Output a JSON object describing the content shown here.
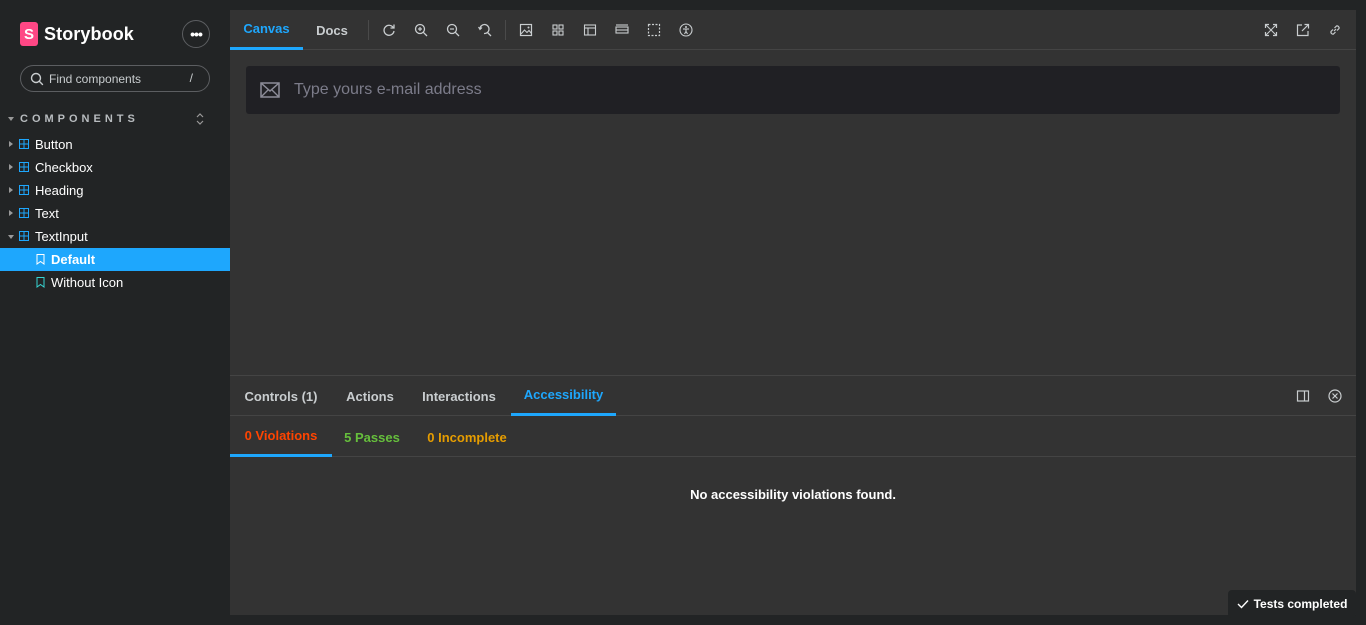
{
  "sidebar": {
    "brand": {
      "logo_letter": "S",
      "name": "Storybook"
    },
    "menu_button": "•••",
    "search": {
      "placeholder": "Find components",
      "shortcut": "/"
    },
    "section_title": "COMPONENTS",
    "items": [
      {
        "label": "Button",
        "type": "component",
        "expanded": false
      },
      {
        "label": "Checkbox",
        "type": "component",
        "expanded": false
      },
      {
        "label": "Heading",
        "type": "component",
        "expanded": false
      },
      {
        "label": "Text",
        "type": "component",
        "expanded": false
      },
      {
        "label": "TextInput",
        "type": "component",
        "expanded": true
      },
      {
        "label": "Default",
        "type": "story",
        "selected": true
      },
      {
        "label": "Without Icon",
        "type": "story",
        "selected": false
      }
    ]
  },
  "toolbar": {
    "tabs": [
      {
        "label": "Canvas",
        "active": true
      },
      {
        "label": "Docs",
        "active": false
      }
    ],
    "icons": [
      "reload-icon",
      "zoom-in-icon",
      "zoom-out-icon",
      "zoom-reset-icon",
      "background-icon",
      "grid-icon",
      "viewport-icon",
      "measure-icon",
      "outline-icon",
      "accessibility-icon"
    ],
    "right_icons": [
      "fullscreen-icon",
      "open-new-tab-icon",
      "copy-link-icon"
    ]
  },
  "canvas": {
    "email_input": {
      "placeholder": "Type yours e-mail address",
      "value": ""
    }
  },
  "panel": {
    "tabs": [
      {
        "label": "Controls (1)",
        "active": false
      },
      {
        "label": "Actions",
        "active": false
      },
      {
        "label": "Interactions",
        "active": false
      },
      {
        "label": "Accessibility",
        "active": true
      }
    ],
    "a11y_tabs": {
      "violations": "0 Violations",
      "passes": "5 Passes",
      "incomplete": "0 Incomplete"
    },
    "message": "No accessibility violations found."
  },
  "status": {
    "label": "Tests completed"
  },
  "colors": {
    "accent": "#1ea7fd",
    "brand": "#ff4785",
    "violations": "#ff4400",
    "passes": "#66bf3c",
    "incomplete": "#e69d00"
  }
}
